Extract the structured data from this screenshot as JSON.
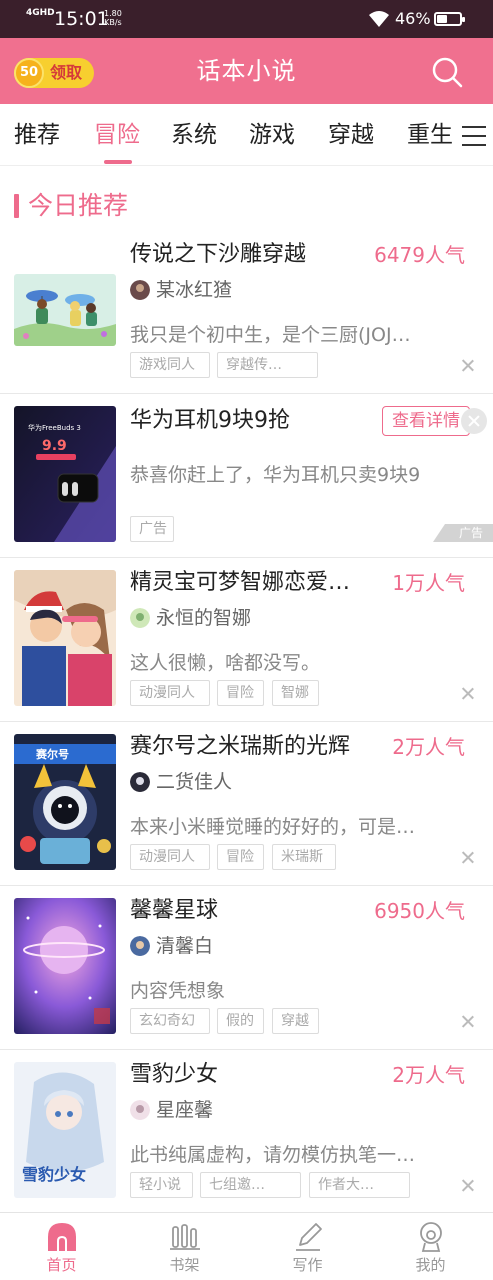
{
  "status_bar": {
    "network": "4GHD",
    "time": "15:01",
    "speed_value": "1.80",
    "speed_unit": "KB/s",
    "battery_percent": "46%",
    "battery_level": 0.46
  },
  "header": {
    "reward_coin": "50",
    "reward_label": "领取",
    "title": "话本小说",
    "search_icon": "search-icon"
  },
  "tabs": [
    {
      "label": "推荐",
      "active": false
    },
    {
      "label": "冒险",
      "active": true
    },
    {
      "label": "系统",
      "active": false
    },
    {
      "label": "游戏",
      "active": false
    },
    {
      "label": "穿越",
      "active": false
    },
    {
      "label": "重生",
      "active": false
    }
  ],
  "section": {
    "title": "今日推荐"
  },
  "books": [
    {
      "title": "传说之下沙雕穿越",
      "popularity": "6479人气",
      "author": "某冰红猹",
      "description": "我只是个初中生，是个三厨(JOJ…",
      "tags": [
        "游戏同人",
        "穿越传…"
      ]
    },
    {
      "title": "精灵宝可梦智娜恋爱…",
      "popularity": "1万人气",
      "author": "永恒的智娜",
      "description": "这人很懒，啥都没写。",
      "tags": [
        "动漫同人",
        "冒险",
        "智娜"
      ]
    },
    {
      "title": "赛尔号之米瑞斯的光辉",
      "popularity": "2万人气",
      "author": "二货佳人",
      "description": "本来小米睡觉睡的好好的，可是…",
      "tags": [
        "动漫同人",
        "冒险",
        "米瑞斯"
      ]
    },
    {
      "title": "馨馨星球",
      "popularity": "6950人气",
      "author": "清馨白",
      "description": "内容凭想象",
      "tags": [
        "玄幻奇幻",
        "假的",
        "穿越"
      ]
    },
    {
      "title": "雪豹少女",
      "popularity": "2万人气",
      "author": "星座馨",
      "description": "此书纯属虚构，请勿模仿执笔一…",
      "tags": [
        "轻小说",
        "七组邀…",
        "作者大…"
      ]
    }
  ],
  "ad": {
    "title": "华为耳机9块9抢",
    "detail_button": "查看详情",
    "description": "恭喜你赶上了，华为耳机只卖9块9",
    "tag": "广告",
    "badge": "广告",
    "cover_text": "华为FreeBuds 3",
    "cover_price": "9.9"
  },
  "cover_texts": {
    "book3": "赛尔号",
    "book5": "雪豹少女"
  },
  "bottom_nav": [
    {
      "label": "首页",
      "icon": "home-icon",
      "active": true
    },
    {
      "label": "书架",
      "icon": "bookshelf-icon",
      "active": false
    },
    {
      "label": "写作",
      "icon": "pencil-icon",
      "active": false
    },
    {
      "label": "我的",
      "icon": "profile-icon",
      "active": false
    }
  ],
  "colors": {
    "accent": "#ee6b8c",
    "header_bg": "#f0708f",
    "status_bar_bg": "#3a1f2b"
  }
}
